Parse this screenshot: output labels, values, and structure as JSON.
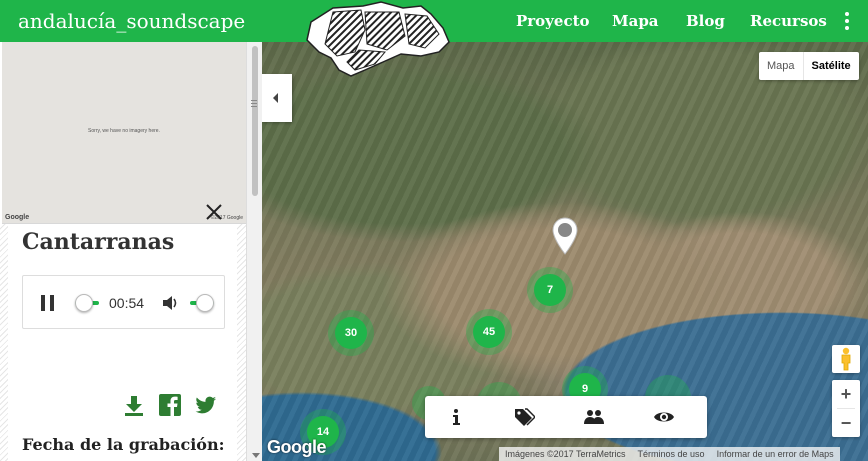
{
  "header": {
    "brand": "andalucía_soundscape",
    "nav": [
      "Proyecto",
      "Mapa",
      "Blog",
      "Recursos"
    ],
    "menu_icon": "more-vert-icon",
    "logo_icon": "andalucia-map-logo",
    "color": "#1fb54a"
  },
  "streetview": {
    "no_imagery": "Sorry, we have no imagery here.",
    "google": "Google",
    "copyright": "©2017 Google"
  },
  "recording": {
    "title": "Cantarranas",
    "time": "00:54",
    "progress": 0.05,
    "volume": 1.0,
    "date_label": "Fecha de la grabación:"
  },
  "actions": [
    "download-icon",
    "facebook-icon",
    "twitter-icon"
  ],
  "map": {
    "type_buttons": [
      "Mapa",
      "Satélite"
    ],
    "active_type": "Satélite",
    "clusters": [
      "30",
      "45",
      "7",
      "9",
      "14"
    ],
    "toolbar": [
      "info-icon",
      "tags-icon",
      "users-icon",
      "eye-icon"
    ],
    "zoom_in": "+",
    "zoom_out": "−",
    "google": "Google",
    "attribution": [
      "Imágenes ©2017 TerraMetrics",
      "Términos de uso",
      "Informar de un error de Maps"
    ]
  }
}
